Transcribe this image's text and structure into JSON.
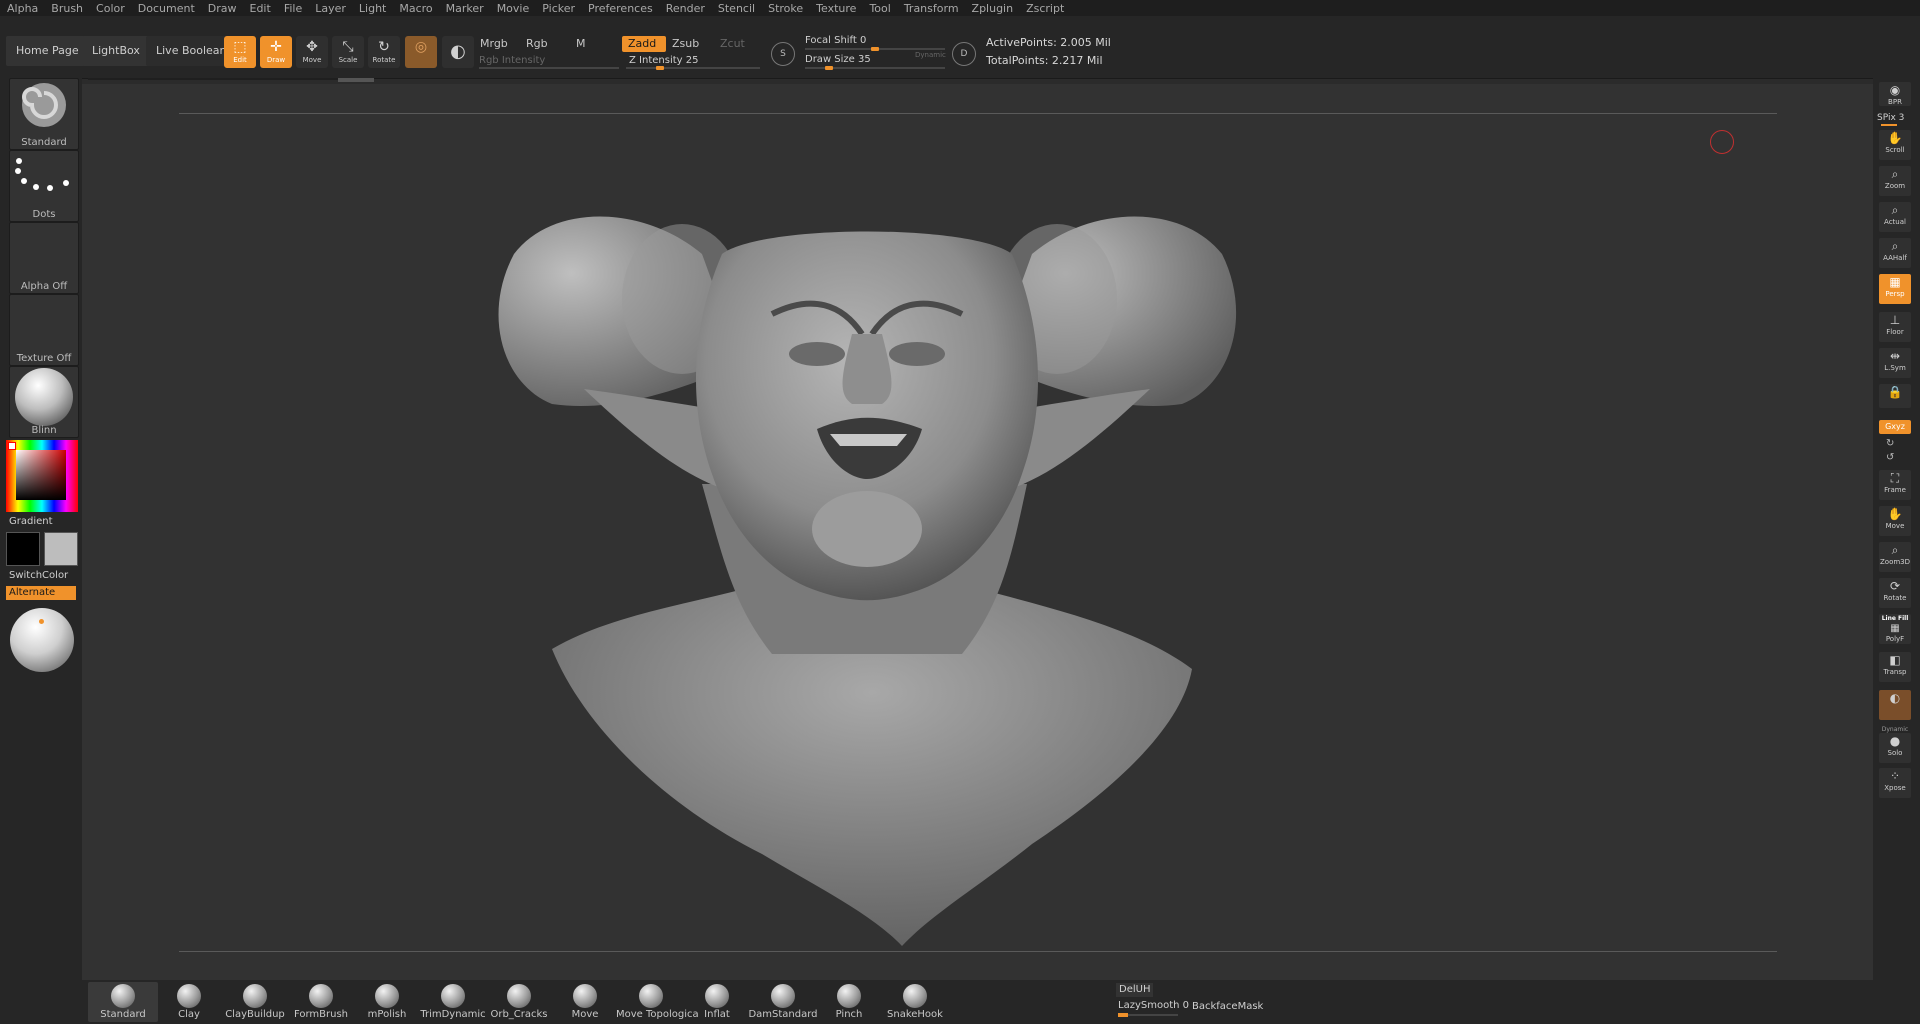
{
  "menu": [
    "Alpha",
    "Brush",
    "Color",
    "Document",
    "Draw",
    "Edit",
    "File",
    "Layer",
    "Light",
    "Macro",
    "Marker",
    "Movie",
    "Picker",
    "Preferences",
    "Render",
    "Stencil",
    "Stroke",
    "Texture",
    "Tool",
    "Transform",
    "Zplugin",
    "Zscript"
  ],
  "toolbar": {
    "home_page": "Home Page",
    "lightbox": "LightBox",
    "live_boolean": "Live Boolean",
    "edit": "Edit",
    "draw": "Draw",
    "move": "Move",
    "scale": "Scale",
    "rotate": "Rotate",
    "mrgb": "Mrgb",
    "rgb": "Rgb",
    "m": "M",
    "rgb_intensity": "Rgb Intensity",
    "zadd": "Zadd",
    "zsub": "Zsub",
    "zcut": "Zcut",
    "z_intensity": "Z Intensity 25",
    "focal_shift": "Focal Shift 0",
    "draw_size": "Draw Size 35",
    "dynamic": "Dynamic",
    "active_points": "ActivePoints: 2.005 Mil",
    "total_points": "TotalPoints: 2.217 Mil",
    "s_icon": "S",
    "d_icon": "D"
  },
  "left": {
    "brush": "Standard",
    "stroke": "Dots",
    "alpha": "Alpha Off",
    "texture": "Texture Off",
    "material": "Blinn",
    "gradient": "Gradient",
    "switch_color": "SwitchColor",
    "alternate": "Alternate"
  },
  "right": {
    "spix": "SPix 3",
    "bpr": "BPR",
    "scroll": "Scroll",
    "zoom": "Zoom",
    "actual": "Actual",
    "aahalf": "AAHalf",
    "persp": "Persp",
    "floor": "Floor",
    "lsym": "L.Sym",
    "xyz": "Gxyz",
    "frame": "Frame",
    "move": "Move",
    "zoom3d": "Zoom3D",
    "rotate": "Rotate",
    "line_fill": "Line Fill",
    "polyf": "PolyF",
    "transp": "Transp",
    "dynamic": "Dynamic",
    "solo": "Solo",
    "xpose": "Xpose"
  },
  "bottom": {
    "brushes": [
      "Standard",
      "Clay",
      "ClayBuildup",
      "FormBrush",
      "mPolish",
      "TrimDynamic",
      "Orb_Cracks",
      "Move",
      "Move Topologica",
      "Inflat",
      "DamStandard",
      "Pinch",
      "SnakeHook"
    ],
    "deluh": "DelUH",
    "lazysmooth": "LazySmooth 0",
    "backfacemask": "BackfaceMask"
  },
  "sliders": {
    "z_intensity": 0.25,
    "focal_shift": 0.5,
    "draw_size": 0.17
  },
  "colors": {
    "accent": "#f0922b",
    "bg": "#2b2b2b",
    "canvas": "#323232"
  }
}
